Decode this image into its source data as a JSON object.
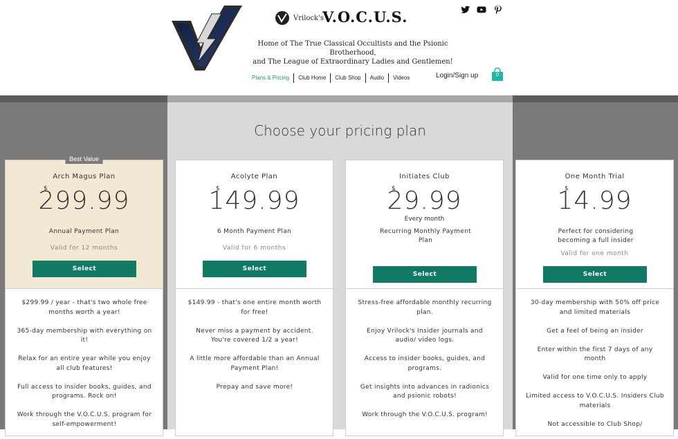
{
  "header": {
    "brand_small": "Vrilock's",
    "brand_big": "V.O.C.U.S.",
    "tagline_1": "Home of The True Classical Occultists and the Psionic Brotherhood,",
    "tagline_2": "and The League of Extraordinary Ladies and Gentlemen!",
    "nav": [
      "Plans & Pricing",
      "Club Home",
      "Club Shop",
      "Audio",
      "Videos"
    ],
    "login": "Login/Sign up",
    "cart_count": "0",
    "social_icons": [
      "twitter-icon",
      "youtube-icon",
      "pinterest-icon"
    ]
  },
  "title": "Choose your pricing plan",
  "colors": {
    "accent": "#117a65",
    "nav_active": "#1f9a86",
    "best_bg": "#f3e8d4"
  },
  "plans": [
    {
      "badge": "Best Value",
      "name": "Arch Magus Plan",
      "currency": "$",
      "price": "299.99",
      "desc": "Annual Payment Plan",
      "valid": "Valid for 12 months",
      "button": "Select",
      "features": [
        "$299.99 / year - that's two whole free months worth a year!",
        "365-day membership with everything on it!",
        "Relax for an entire year while you enjoy all club features!",
        "Full access to insider books, guides, and programs. Rock on!",
        "Work through the V.O.C.U.S. program for self-empowerment!"
      ]
    },
    {
      "name": "Acolyte Plan",
      "currency": "$",
      "price": "149.99",
      "desc": "6 Month Payment Plan",
      "valid": "Valid for 6 months",
      "button": "Select",
      "features": [
        "$149.99 - that's one entire month worth for free!",
        "Never miss a payment by accident. You're covered 1/2 a year!",
        "A little more affordable than an Annual Payment Plan!",
        "Prepay and save more!"
      ]
    },
    {
      "name": "Initiates Club",
      "currency": "$",
      "price": "29.99",
      "price_sub": "Every month",
      "desc": "Recurring Monthly Payment Plan",
      "button": "Select",
      "features": [
        "Stress-free affordable monthly recurring plan.",
        "Enjoy Vrilock's Insider journals and audio/ video logs.",
        "Access to insider books, guides, and programs.",
        "Get insights into advances in radionics and psionic robots!",
        "Work through the V.O.C.U.S. program!"
      ]
    },
    {
      "name": "One Month Trial",
      "currency": "$",
      "price": "14.99",
      "desc": "Perfect for considering becoming a full insider",
      "valid": "Valid for one month",
      "button": "Select",
      "features": [
        "30-day membership with 50% off price and limited materials",
        "Get a feel of being an insider",
        "Enter within the first 7 days of any month",
        "Valid for one time only to apply",
        "Limited access to V.O.C.U.S. Insiders Club materials",
        "Not accessible to Club Shop/"
      ]
    }
  ]
}
